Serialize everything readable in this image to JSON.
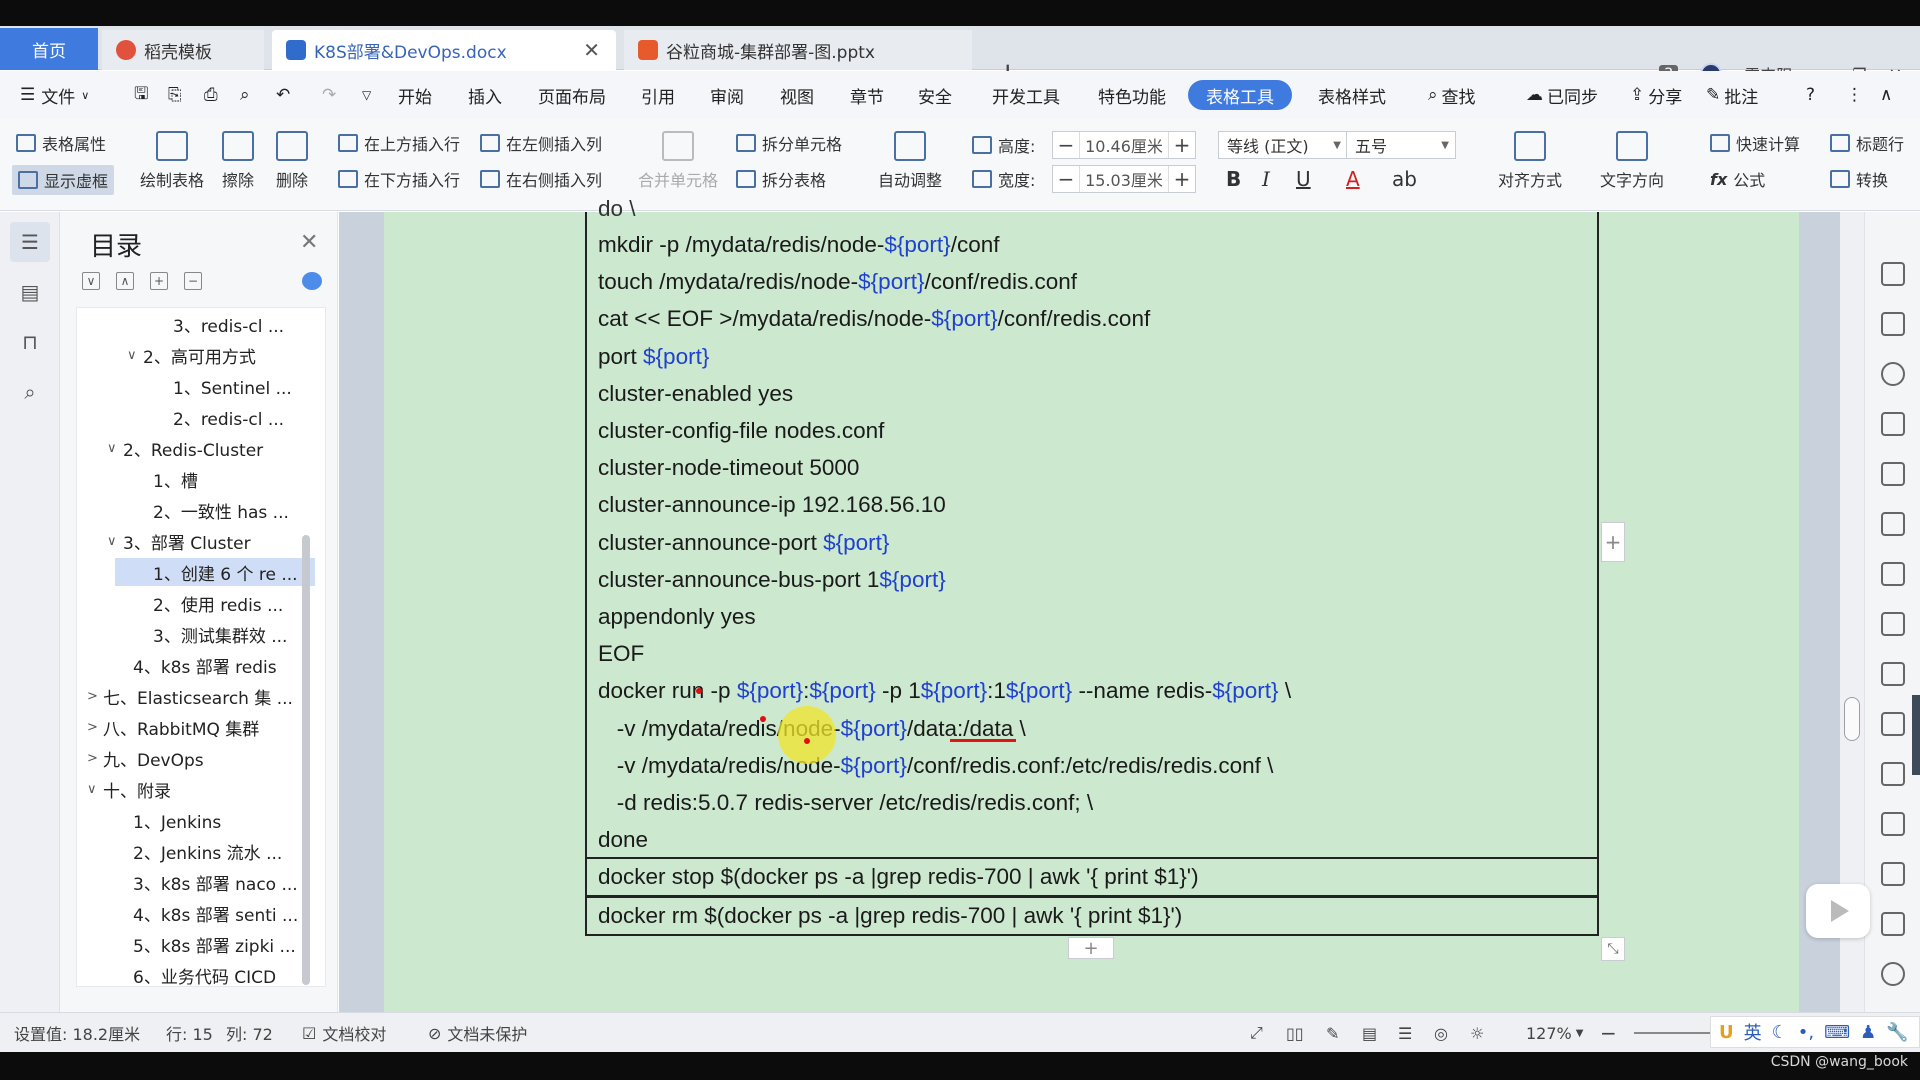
{
  "tabs": {
    "home": "首页",
    "items": [
      {
        "label": "稻壳模板",
        "icon": "wps-docer-icon"
      },
      {
        "label": "K8S部署&DevOps.docx",
        "icon": "word-doc-icon"
      },
      {
        "label": "谷粒商城-集群部署-图.pptx",
        "icon": "ppt-icon"
      }
    ],
    "new_tab": "+",
    "window_badge": "2",
    "user": "雷丰阳"
  },
  "menu": {
    "file": "文件",
    "items": [
      "开始",
      "插入",
      "页面布局",
      "引用",
      "审阅",
      "视图",
      "章节",
      "安全",
      "开发工具",
      "特色功能",
      "表格工具",
      "表格样式"
    ],
    "active": "表格工具",
    "search": "查找",
    "synced": "已同步",
    "share": "分享",
    "annotate": "批注"
  },
  "ribbon": {
    "table_props": "表格属性",
    "show_grid": "显示虚框",
    "draw_table": "绘制表格",
    "erase": "擦除",
    "delete": "删除",
    "insert_above": "在上方插入行",
    "insert_below": "在下方插入行",
    "insert_left": "在左侧插入列",
    "insert_right": "在右侧插入列",
    "merge_cells": "合并单元格",
    "split_cells": "拆分单元格",
    "split_table": "拆分表格",
    "autofit": "自动调整",
    "height_label": "高度:",
    "height_value": "10.46厘米",
    "width_label": "宽度:",
    "width_value": "15.03厘米",
    "font_name": "等线 (正文)",
    "font_size": "五号",
    "bold": "B",
    "italic": "I",
    "underline": "U",
    "align": "对齐方式",
    "text_direction": "文字方向",
    "quick_calc": "快速计算",
    "formula": "公式",
    "title_row": "标题行",
    "convert": "转换"
  },
  "toc": {
    "title": "目录",
    "items": [
      {
        "text": "3、redis-cl ...",
        "caret": ""
      },
      {
        "text": "2、高可用方式",
        "caret": "∨"
      },
      {
        "text": "1、Sentinel ...",
        "caret": ""
      },
      {
        "text": "2、redis-cl ...",
        "caret": ""
      },
      {
        "text": "2、Redis-Cluster",
        "caret": "∨"
      },
      {
        "text": "1、槽",
        "caret": ""
      },
      {
        "text": "2、一致性 has ...",
        "caret": ""
      },
      {
        "text": "3、部署 Cluster",
        "caret": "∨"
      },
      {
        "text": "1、创建 6 个 re ...",
        "caret": ""
      },
      {
        "text": "2、使用 redis ...",
        "caret": ""
      },
      {
        "text": "3、测试集群效 ...",
        "caret": ""
      },
      {
        "text": "4、k8s 部署 redis",
        "caret": ""
      },
      {
        "text": "七、Elasticsearch 集 ...",
        "caret": ">"
      },
      {
        "text": "八、RabbitMQ 集群",
        "caret": ">"
      },
      {
        "text": "九、DevOps",
        "caret": ">"
      },
      {
        "text": "十、附录",
        "caret": "∨"
      },
      {
        "text": "1、Jenkins",
        "caret": ""
      },
      {
        "text": "2、Jenkins 流水 ...",
        "caret": ""
      },
      {
        "text": "3、k8s 部署 naco ...",
        "caret": ""
      },
      {
        "text": "4、k8s 部署 senti ...",
        "caret": ""
      },
      {
        "text": "5、k8s 部署 zipki ...",
        "caret": ""
      },
      {
        "text": "6、业务代码 CICD",
        "caret": ""
      }
    ],
    "selected_index": 8
  },
  "document": {
    "top_partial": "do \\",
    "lines": [
      "mkdir -p /mydata/redis/node-${port}/conf",
      "touch /mydata/redis/node-${port}/conf/redis.conf",
      "cat << EOF >/mydata/redis/node-${port}/conf/redis.conf",
      "port ${port}",
      "cluster-enabled yes",
      "cluster-config-file nodes.conf",
      "cluster-node-timeout 5000",
      "cluster-announce-ip 192.168.56.10",
      "cluster-announce-port ${port}",
      "cluster-announce-bus-port 1${port}",
      "appendonly yes",
      "EOF",
      "docker run -p ${port}:${port} -p 1${port}:1${port} --name redis-${port} \\",
      "   -v /mydata/redis/node-${port}/data:/data \\",
      "   -v /mydata/redis/node-${port}/conf/redis.conf:/etc/redis/redis.conf \\",
      "   -d redis:5.0.7 redis-server /etc/redis/redis.conf; \\",
      "done"
    ],
    "row2": "docker stop $(docker ps -a |grep redis-700 | awk '{ print $1}')",
    "row3": "docker rm $(docker ps -a |grep redis-700 | awk '{ print $1}')"
  },
  "status": {
    "setting": "设置值: 18.2厘米",
    "row": "行: 15",
    "col": "列: 72",
    "proofread": "文档校对",
    "unprotected": "文档未保护",
    "zoom": "127%",
    "ime_lang": "英"
  },
  "watermark": "CSDN @wang_book",
  "colors": {
    "accent": "#3f7bdf",
    "doc_bg": "#cce8cf",
    "variable_blue": "#2040d0"
  }
}
